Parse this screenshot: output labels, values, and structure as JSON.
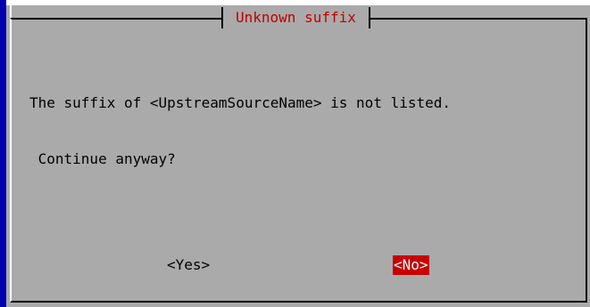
{
  "dialog": {
    "title": "Unknown suffix",
    "message_lines": [
      "The suffix of <UpstreamSourceName> is not listed.",
      " Continue anyway?"
    ],
    "buttons": {
      "yes": "<Yes>",
      "no": "<No>"
    },
    "selected_button": "no"
  },
  "colors": {
    "backdrop": "#0000ae",
    "dialog_background": "#aaaaaa",
    "title_text": "#c00000",
    "selected_button_background": "#c80000",
    "selected_button_text": "#ffffff"
  }
}
